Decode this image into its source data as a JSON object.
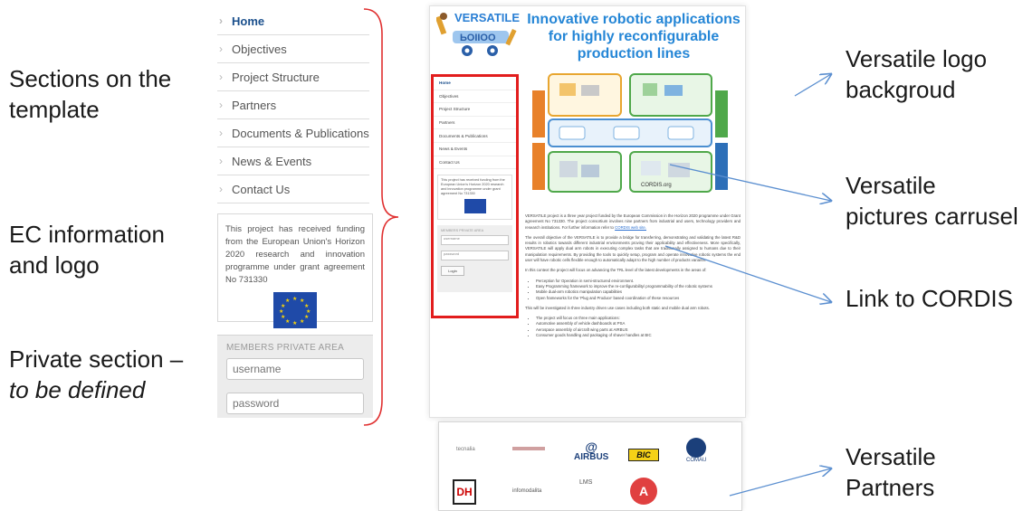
{
  "annotations_left": {
    "sections": [
      "Sections on the",
      "template"
    ],
    "ec": [
      "EC information",
      "and logo"
    ],
    "private_line1": "Private section –",
    "private_line2": "to be defined"
  },
  "annotations_right": {
    "logo_bg": [
      "Versatile logo",
      "backgroud"
    ],
    "carrusel": [
      "Versatile",
      "pictures carrusel"
    ],
    "cordis": "Link to CORDIS",
    "partners": [
      "Versatile",
      "Partners"
    ]
  },
  "menu": {
    "items": [
      {
        "label": "Home",
        "active": true
      },
      {
        "label": "Objectives"
      },
      {
        "label": "Project Structure"
      },
      {
        "label": "Partners"
      },
      {
        "label": "Documents & Publications"
      },
      {
        "label": "News & Events"
      },
      {
        "label": "Contact Us"
      }
    ]
  },
  "ec_box": {
    "text": "This project has received funding from the European Union's Horizon 2020 research and innovation programme under grant agreement No 731330"
  },
  "members": {
    "title": "MEMBERS PRIVATE AREA",
    "username_placeholder": "username",
    "password_placeholder": "password"
  },
  "page": {
    "logo_text": "VERSATILE",
    "headline": [
      "Innovative robotic applications",
      "for highly reconfigurable",
      "production lines"
    ],
    "mini_menu": [
      "Home",
      "Objectives",
      "Project Structure",
      "Partners",
      "Documents & Publications",
      "News & Events",
      "Contact Us"
    ],
    "mini_ec": "This project has received funding from the European Union's Horizon 2020 research and innovation programme under grant agreement No 731330",
    "mini_members_title": "MEMBERS PRIVATE AREA",
    "mini_username": "username",
    "mini_password": "password",
    "mini_login": "Login",
    "diagram": {
      "boxes": [
        "Perception for Operation in Semi-structured Environments",
        "Automatic programming tools for highly reconfigurable robot tasks",
        "Technologies transfer and validation",
        "Mobile Dual arm robots advanced manipulation capabilities",
        "Synchronization and control framework"
      ],
      "footer_labels": [
        "Solution",
        "Solution",
        "Solution",
        "Solution"
      ],
      "site": "CORDIS.org"
    },
    "paragraphs": [
      "VERSATILE project is a three year project funded by the European Commission in the Horizon 2020 programme under Grant agreement No 731330. The project consortium involves nine partners from industrial and users, technology providers and research institutions. For further information refer to",
      "The overall objective of the VERSATILE is to provide a bridge for transferring, demonstrating and validating the latest R&D results in robotics towards different industrial environments proving their applicability and effectiveness. More specifically, VERSATILE will apply dual arm robots in executing complex tasks that are traditionally assigned to humans due to their manipulation requirements. By providing the tools to quickly setup, program and operate innovative robotic systems the end user will have robotic cells flexible enough to automatically adapt to the high number of products variants.",
      "In this context the project will focus on advancing the TRL level of the latest developments in the areas of:"
    ],
    "cordis_link": "CORDIS web site.",
    "bullets1": [
      "Perception for Operation in semi-structured environment.",
      "Easy Programming framework to improve the re-configurability/ programmability of the robotic systems",
      "Mobile dual-arm robotics manipulation capabilities",
      "Open frameworks for the 'Plug and Produce' based coordination of these resources"
    ],
    "p4": "This will be investigated in three industry driven use cases including both static and mobile dual arm robots.",
    "bullets2": [
      "The project will focus on three main applications:",
      "Automotive assembly of vehicle dashboards at PSA",
      "Aerospace assembly of aircraft wing parts at AIRBUS",
      "Consumer goods handling and packaging of shaver handles at BIC"
    ]
  },
  "partners": {
    "row1": [
      "tecnalia",
      "AIRBUS",
      "BIC",
      "COMAU"
    ],
    "row2": [
      "DH",
      "infomodalita",
      "LMS",
      "A"
    ]
  }
}
